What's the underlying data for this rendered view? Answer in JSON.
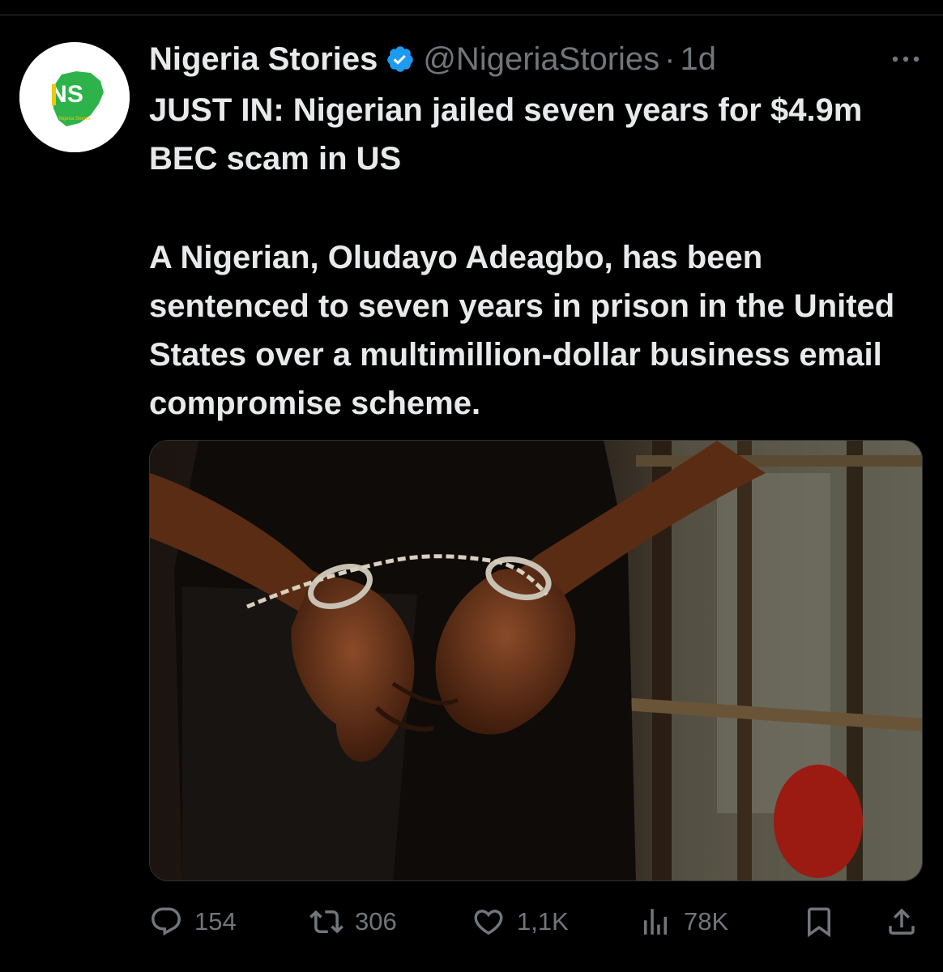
{
  "colors": {
    "background": "#000000",
    "text_primary": "#e7e9ea",
    "text_secondary": "#71767b",
    "verified_blue": "#1d9bf0",
    "logo_green": "#2db34a",
    "logo_yellow": "#f0c808"
  },
  "account": {
    "display_name": "Nigeria Stories",
    "handle": "@NigeriaStories",
    "separator": "·",
    "time": "1d",
    "avatar_logo_text": "NS",
    "avatar_logo_subtext": "Nigeria Stories",
    "verified_icon": "verified-badge-icon"
  },
  "tweet": {
    "headline": "JUST IN: Nigerian jailed seven years for $4.9m BEC scam in US",
    "body": "A Nigerian, Oludayo Adeagbo, has been sentenced to seven years in prison in the United States over a multimillion-dollar business email compromise scheme."
  },
  "media": {
    "icon": "photo-handcuffed-hands"
  },
  "actions": {
    "replies": "154",
    "reposts": "306",
    "likes": "1,1K",
    "views": "78K",
    "icons": [
      "reply-icon",
      "repost-icon",
      "like-icon",
      "views-icon",
      "bookmark-icon",
      "share-icon"
    ]
  }
}
